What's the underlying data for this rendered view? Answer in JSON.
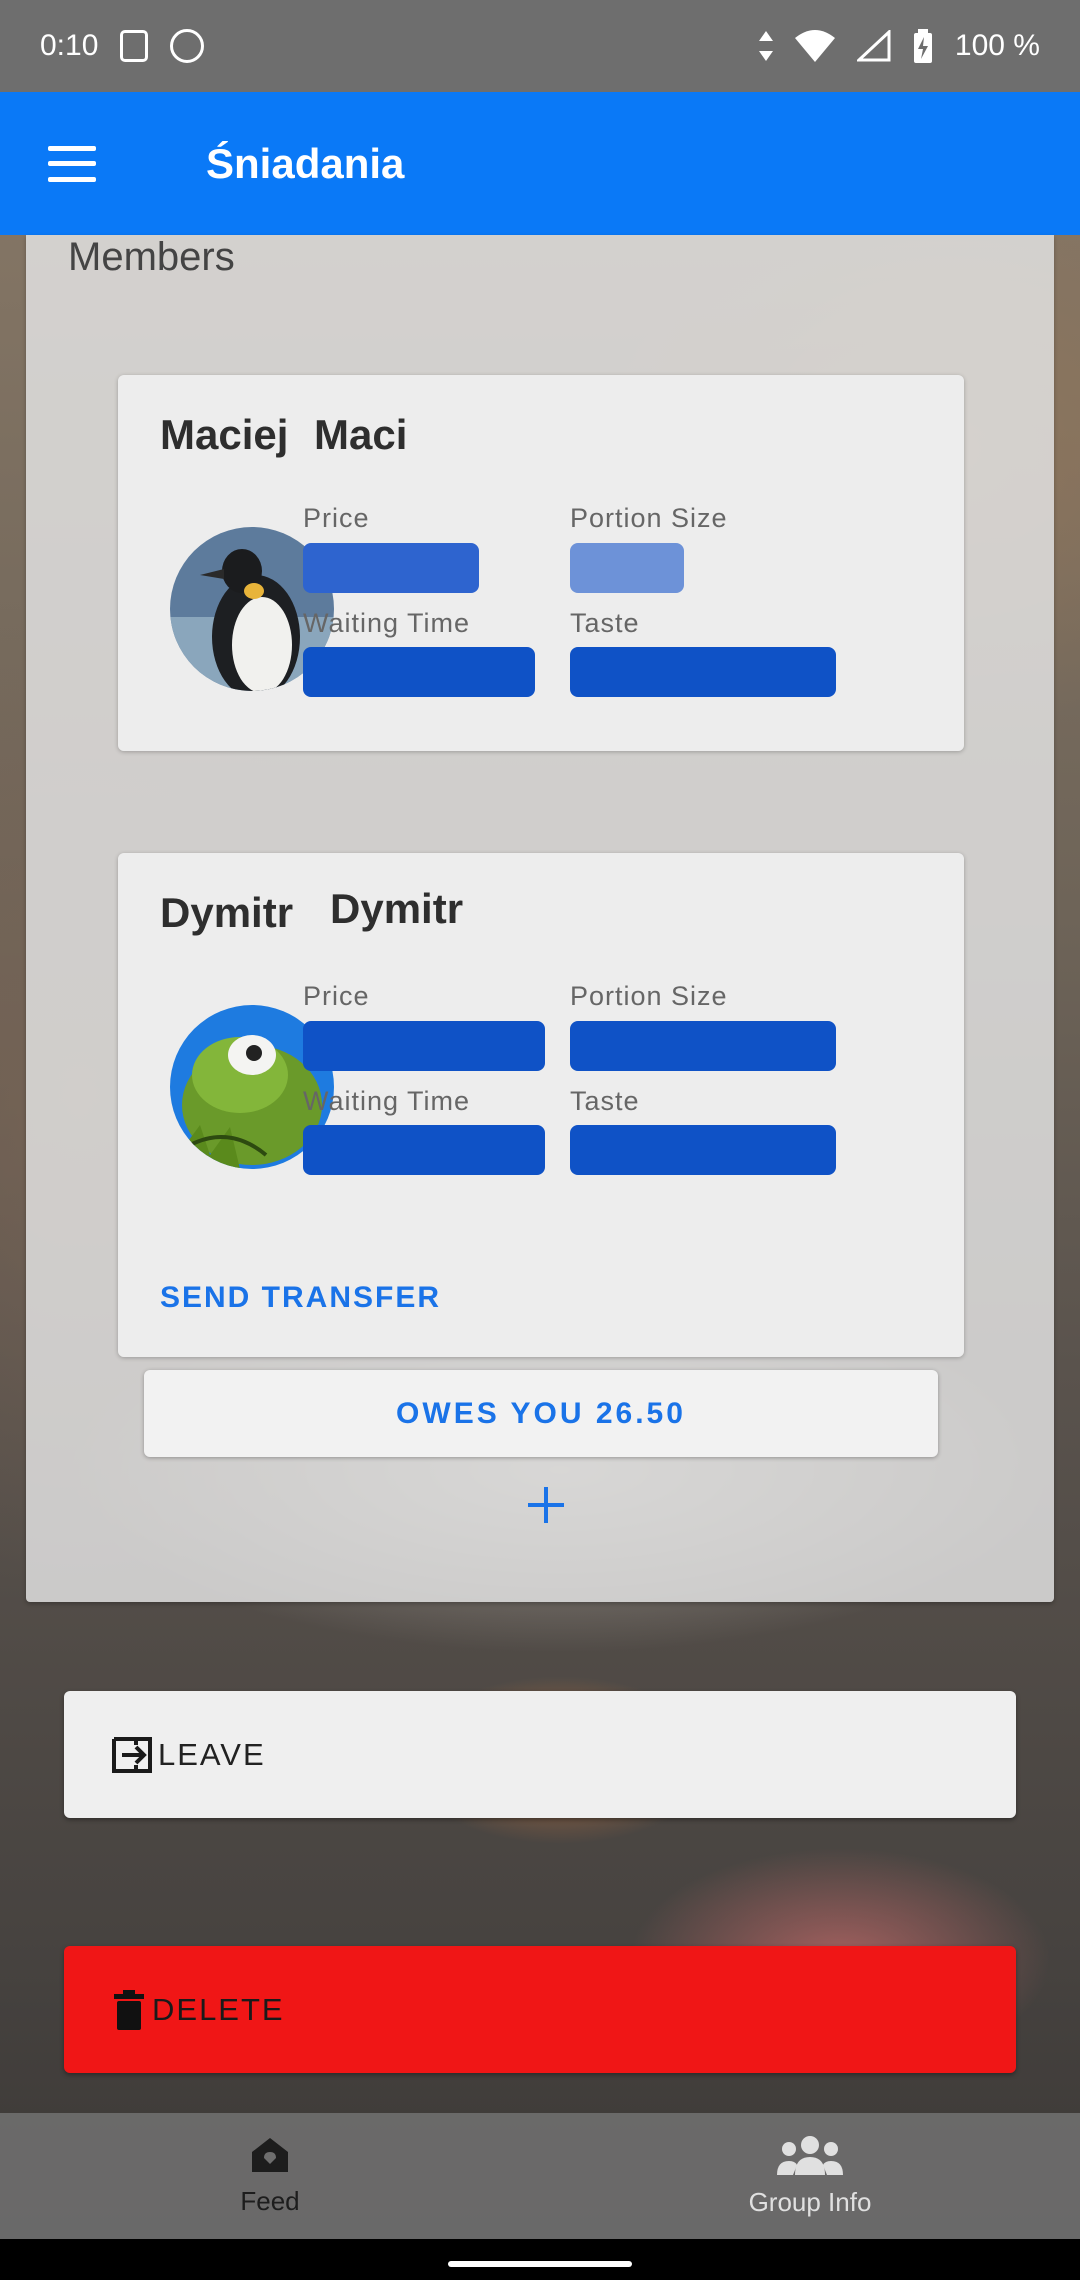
{
  "status_bar": {
    "time": "0:10",
    "battery": "100 %",
    "icons": [
      "sim-card-icon",
      "sync-icon",
      "data-arrows-icon",
      "wifi-icon",
      "signal-icon",
      "battery-icon"
    ]
  },
  "app_bar": {
    "title": "Śniadania",
    "menu_icon": "hamburger-menu-icon",
    "color": "#0a79f7"
  },
  "members": {
    "title": "Members",
    "list": [
      {
        "first_name": "Maciej",
        "last_name": "Maci",
        "avatar": "penguin",
        "ratings": [
          {
            "label": "Price",
            "value": 0.66
          },
          {
            "label": "Portion Size",
            "value": 0.43
          },
          {
            "label": "Waiting Time",
            "value": 0.96
          },
          {
            "label": "Taste",
            "value": 1.0
          }
        ]
      },
      {
        "first_name": "Dymitr",
        "last_name": "Dymitr",
        "avatar": "kermit",
        "ratings": [
          {
            "label": "Price",
            "value": 1.0
          },
          {
            "label": "Portion Size",
            "value": 1.0
          },
          {
            "label": "Waiting Time",
            "value": 1.0
          },
          {
            "label": "Taste",
            "value": 1.0
          }
        ],
        "send_transfer_label": "SEND TRANSFER"
      }
    ],
    "owes_label": "OWES YOU 26.50",
    "add_icon": "plus-icon"
  },
  "actions": {
    "leave_label": "LEAVE",
    "leave_icon": "exit-icon",
    "delete_label": "DELETE",
    "delete_icon": "trash-icon",
    "delete_color": "#f01616"
  },
  "bottom_nav": {
    "items": [
      {
        "label": "Feed",
        "icon": "home-icon"
      },
      {
        "label": "Group Info",
        "icon": "group-icon"
      }
    ]
  }
}
